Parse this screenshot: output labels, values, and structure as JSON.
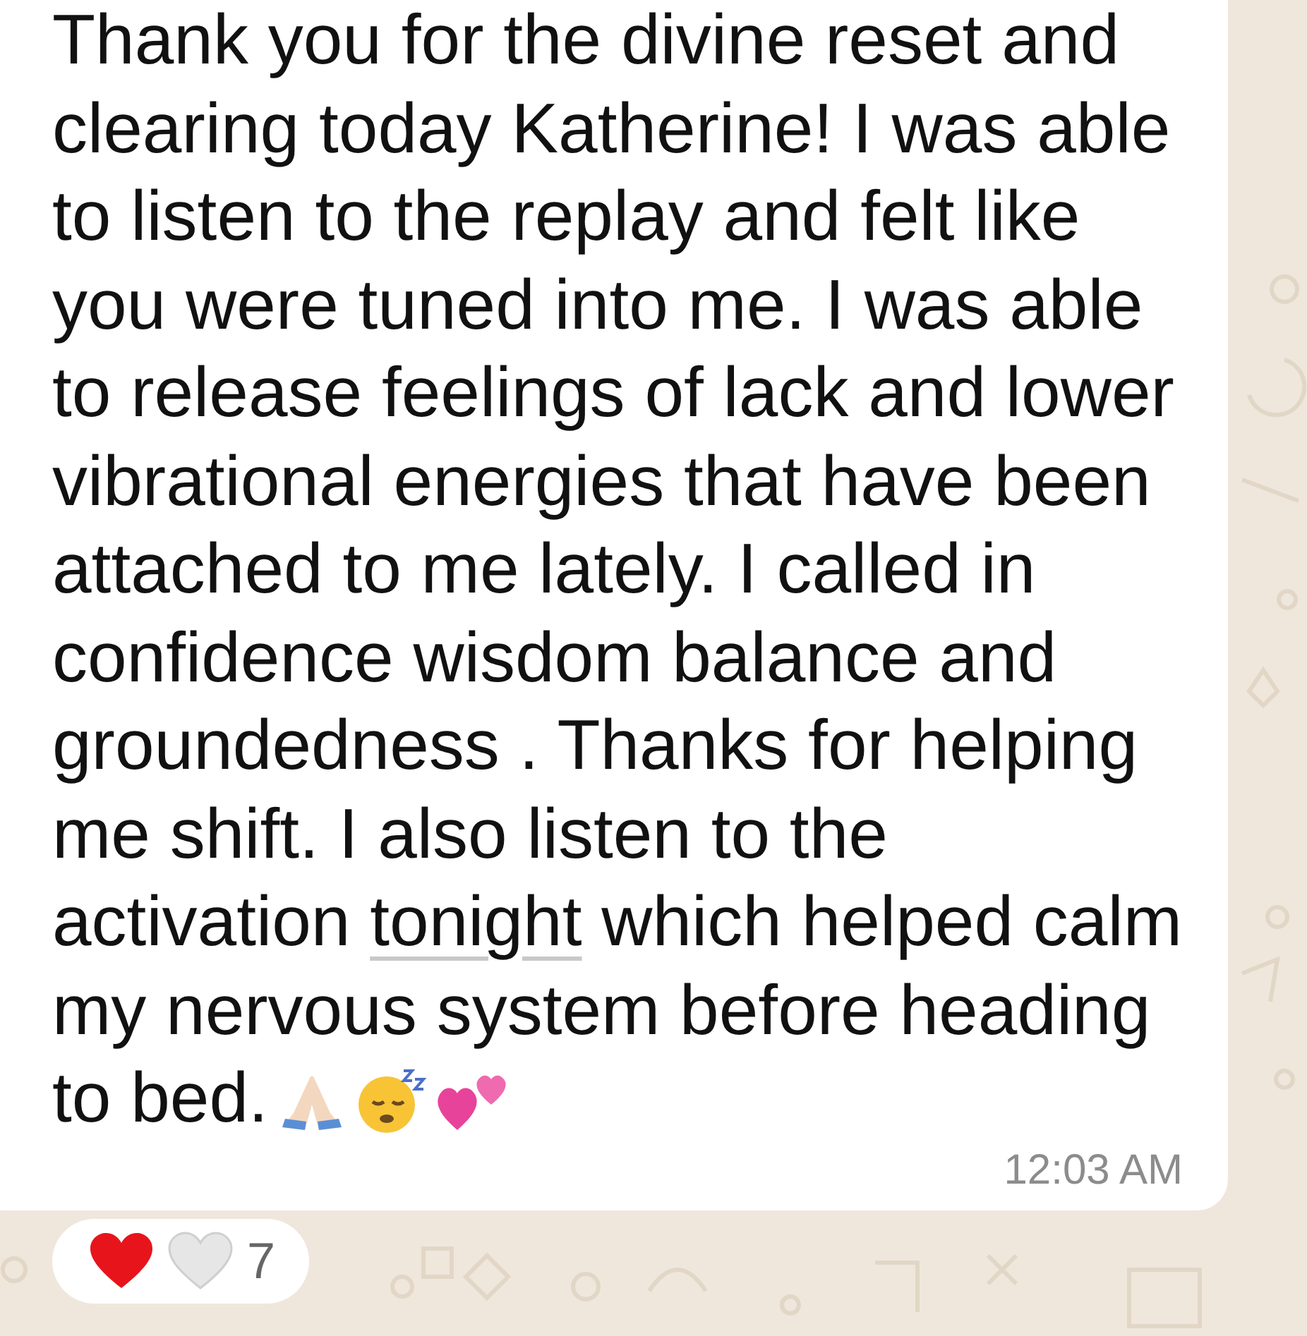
{
  "message": {
    "segments": [
      {
        "kind": "plain",
        "text": "Thank you for the divine reset and clearing today Katherine! I was able to listen to the replay and felt like you were tuned into me. I was able to release feelings of lack and lower vibrational energies that have been attached to me lately. I called in confidence  wisdom balance and groundedness . Thanks for helping me shift. I also listen to the activation "
      },
      {
        "kind": "link",
        "text": "tonight"
      },
      {
        "kind": "plain",
        "text": " which helped calm my nervous system before heading to bed."
      }
    ],
    "time": "12:03 AM"
  },
  "reactions": {
    "count": "7"
  }
}
